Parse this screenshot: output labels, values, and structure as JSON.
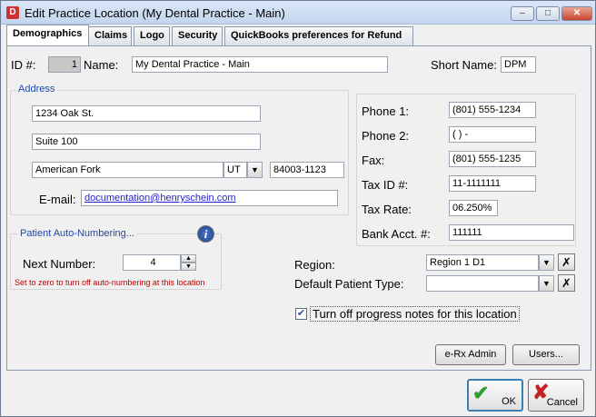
{
  "window": {
    "title": "Edit Practice Location (My Dental Practice - Main)",
    "controls": {
      "minimize": "‒",
      "maximize": "□",
      "close": "✕"
    }
  },
  "tabs": [
    {
      "label": "Demographics",
      "active": true
    },
    {
      "label": "Claims"
    },
    {
      "label": "Logo"
    },
    {
      "label": "Security"
    },
    {
      "label": "QuickBooks preferences for Refund"
    }
  ],
  "header": {
    "id_label": "ID #:",
    "id_value": "1",
    "name_label": "Name:",
    "name_value": "My Dental Practice - Main",
    "short_name_label": "Short Name:",
    "short_name_value": "DPM"
  },
  "address": {
    "group_title": "Address",
    "line1": "1234 Oak St.",
    "line2": "Suite 100",
    "city": "American Fork",
    "state": "UT",
    "zip": "84003-1123",
    "email_label": "E-mail:",
    "email_value": "documentation@henryschein.com"
  },
  "contact": {
    "phone1_label": "Phone 1:",
    "phone1_value": "(801) 555-1234",
    "phone2_label": "Phone 2:",
    "phone2_value": "(   )    -",
    "fax_label": "Fax:",
    "fax_value": "(801) 555-1235",
    "tax_id_label": "Tax ID #:",
    "tax_id_value": "11-1111111",
    "tax_rate_label": "Tax Rate:",
    "tax_rate_value": "06.250%",
    "bank_label": "Bank Acct. #:",
    "bank_value": "111111"
  },
  "auto_numbering": {
    "group_title": "Patient Auto-Numbering...",
    "next_label": "Next Number:",
    "next_value": "4",
    "hint": "Set to zero to turn off auto-numbering at this location"
  },
  "region": {
    "region_label": "Region:",
    "region_value": "Region 1 D1",
    "patient_type_label": "Default Patient Type:",
    "patient_type_value": "",
    "progress_notes_label": "Turn off progress notes for this location",
    "progress_notes_checked": true
  },
  "buttons": {
    "erx": "e-Rx Admin",
    "users": "Users...",
    "ok": "OK",
    "cancel": "Cancel"
  }
}
